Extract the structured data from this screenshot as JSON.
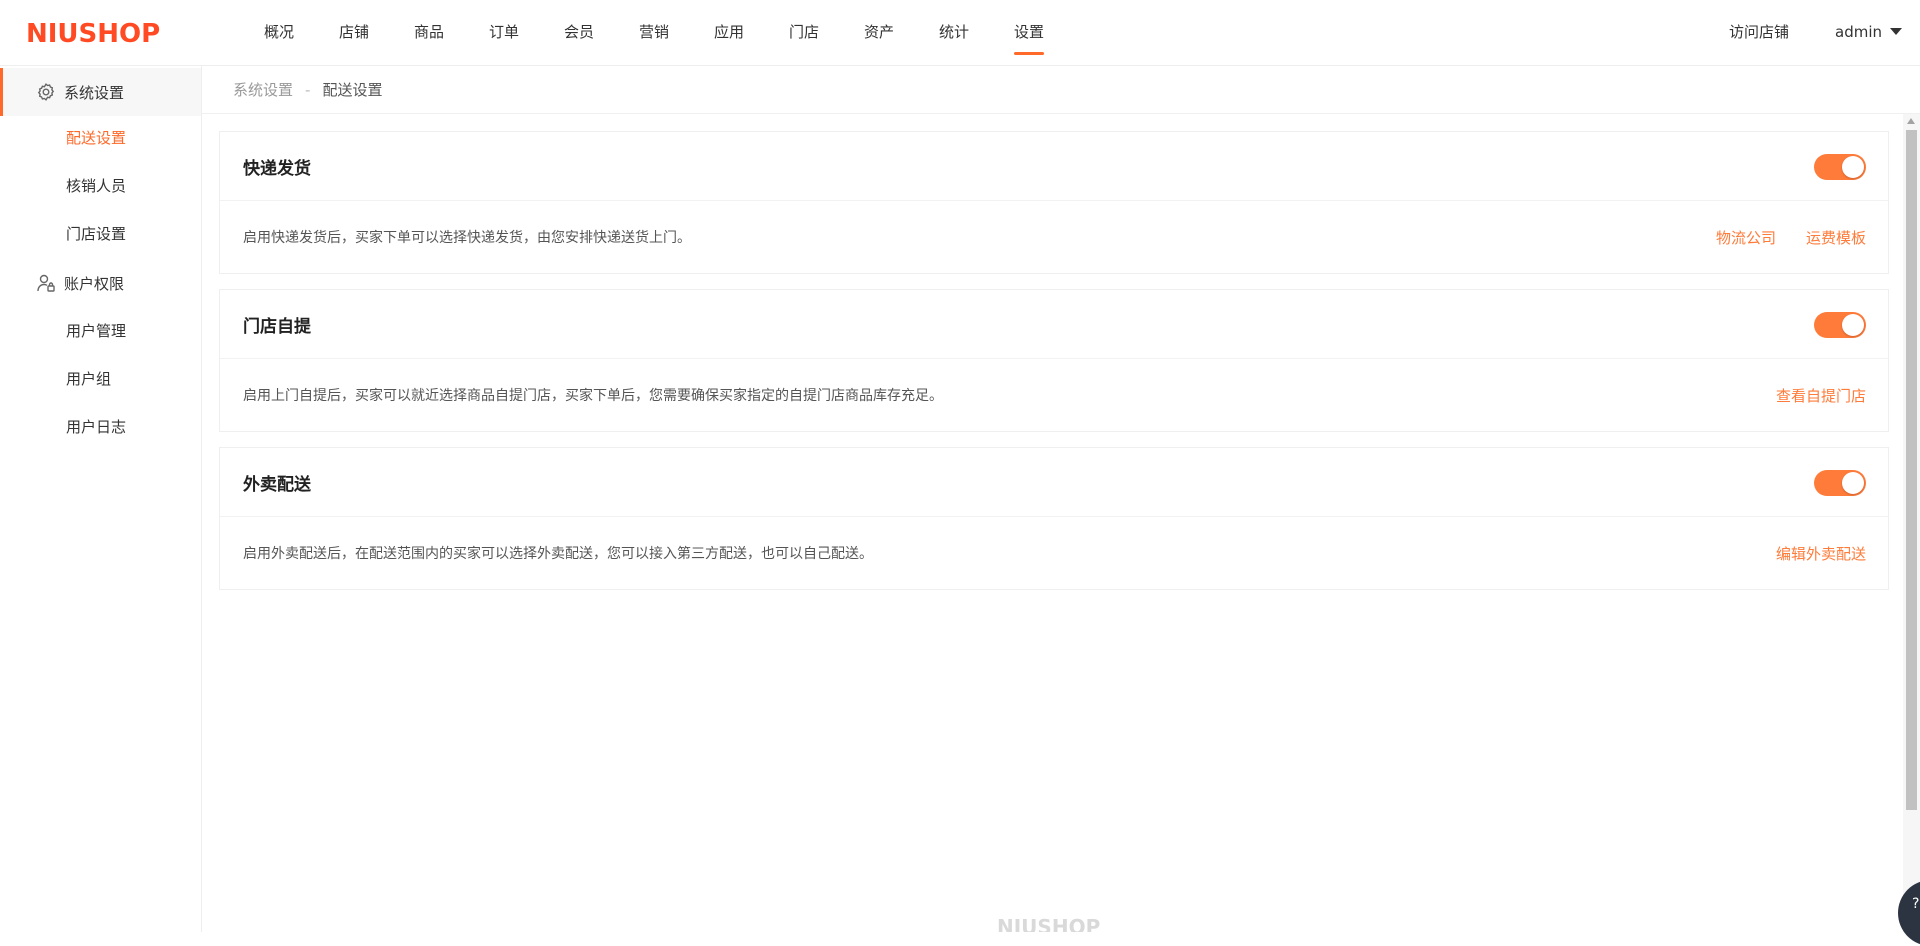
{
  "brand": {
    "logo_text": "NIUSHOP",
    "accent": "#ff6a2a",
    "footer_logo_text": "NIUSHOP"
  },
  "header": {
    "nav": [
      {
        "label": "概况"
      },
      {
        "label": "店铺"
      },
      {
        "label": "商品"
      },
      {
        "label": "订单"
      },
      {
        "label": "会员"
      },
      {
        "label": "营销"
      },
      {
        "label": "应用"
      },
      {
        "label": "门店"
      },
      {
        "label": "资产"
      },
      {
        "label": "统计"
      },
      {
        "label": "设置",
        "active": true
      }
    ],
    "visit_store": "访问店铺",
    "user": "admin"
  },
  "sidebar": {
    "groups": [
      {
        "label": "系统设置",
        "icon": "gear-icon",
        "active": true,
        "items": [
          {
            "label": "配送设置",
            "active": true
          },
          {
            "label": "核销人员"
          },
          {
            "label": "门店设置"
          }
        ]
      },
      {
        "label": "账户权限",
        "icon": "user-lock-icon",
        "items": [
          {
            "label": "用户管理"
          },
          {
            "label": "用户组"
          },
          {
            "label": "用户日志"
          }
        ]
      }
    ]
  },
  "breadcrumb": {
    "parent": "系统设置",
    "separator": "-",
    "current": "配送设置"
  },
  "cards": [
    {
      "title": "快递发货",
      "enabled": true,
      "description": "启用快递发货后，买家下单可以选择快递发货，由您安排快递送货上门。",
      "links": [
        "物流公司",
        "运费模板"
      ]
    },
    {
      "title": "门店自提",
      "enabled": true,
      "description": "启用上门自提后，买家可以就近选择商品自提门店，买家下单后，您需要确保买家指定的自提门店商品库存充足。",
      "links": [
        "查看自提门店"
      ]
    },
    {
      "title": "外卖配送",
      "enabled": true,
      "description": "启用外卖配送后，在配送范围内的买家可以选择外卖配送，您可以接入第三方配送，也可以自己配送。",
      "links": [
        "编辑外卖配送"
      ]
    }
  ]
}
